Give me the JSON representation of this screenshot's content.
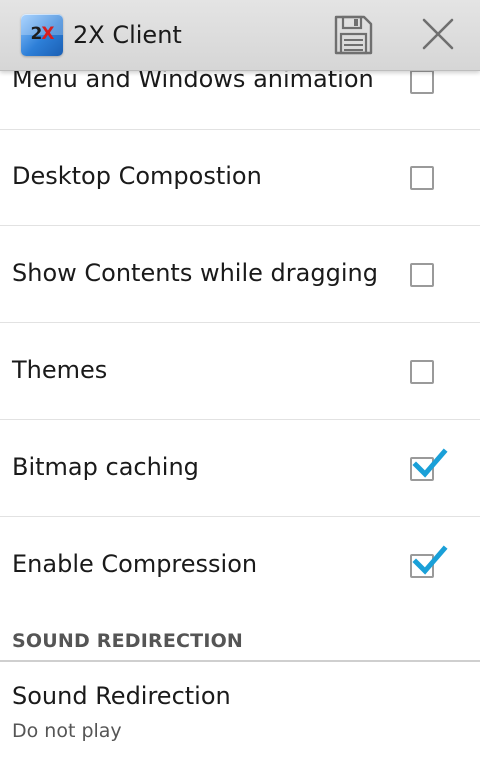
{
  "app": {
    "title": "2X Client",
    "logo_text_2": "2",
    "logo_text_x": "X"
  },
  "toolbar": {
    "save_icon": "floppy-disk-icon",
    "close_icon": "close-x-icon"
  },
  "settings": [
    {
      "label": "Menu and Windows animation",
      "checked": false
    },
    {
      "label": "Desktop Compostion",
      "checked": false
    },
    {
      "label": "Show Contents while dragging",
      "checked": false
    },
    {
      "label": "Themes",
      "checked": false
    },
    {
      "label": "Bitmap caching",
      "checked": true
    },
    {
      "label": "Enable Compression",
      "checked": true
    }
  ],
  "section": {
    "title": "SOUND REDIRECTION"
  },
  "sound": {
    "title": "Sound Redirection",
    "summary": "Do not play"
  },
  "colors": {
    "check_accent": "#1aa0d8",
    "action_bar": "#dcdcdc",
    "logo_x": "#d81e1e"
  }
}
